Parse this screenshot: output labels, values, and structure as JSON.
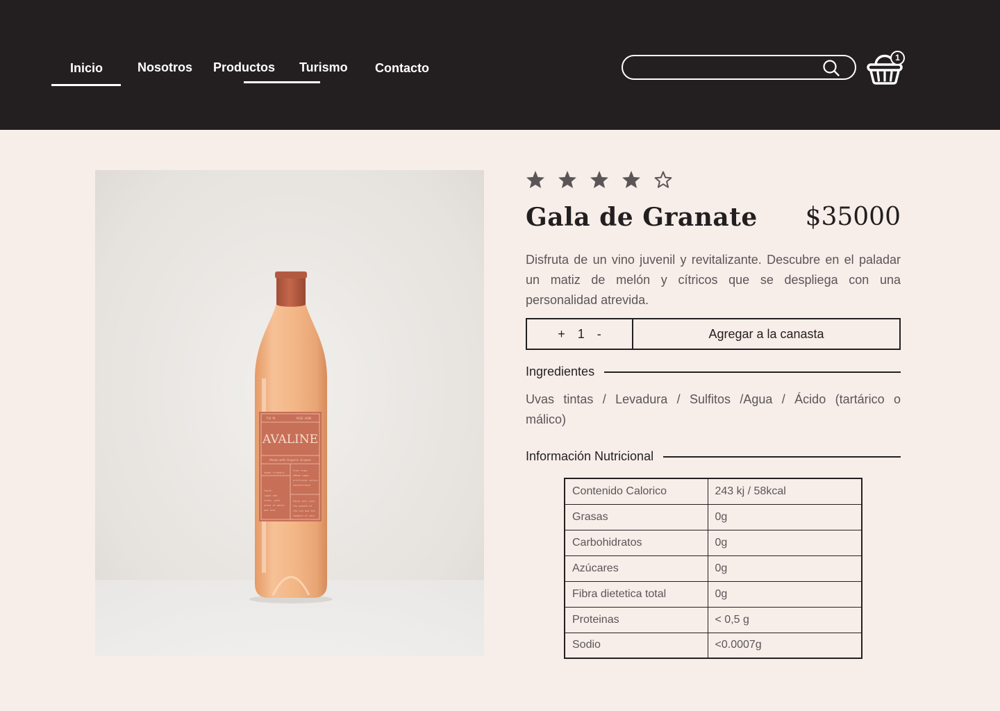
{
  "nav": {
    "items": [
      {
        "label": "Inicio"
      },
      {
        "label": "Nosotros"
      },
      {
        "label": "Productos"
      },
      {
        "label": "Turismo"
      },
      {
        "label": "Contacto"
      }
    ]
  },
  "search": {
    "placeholder": ""
  },
  "cart": {
    "count": "1"
  },
  "product": {
    "rating": 4,
    "rating_max": 5,
    "name": "Gala de Granate",
    "price": "$35000",
    "description": "Disfruta de un vino juvenil y revitalizante. Descubre en el paladar un matiz de melón y cítricos que se despliega con una personalidad atrevida.",
    "bottle": {
      "brand": "AVALINE",
      "subtitle": "Made with Organic Grapes",
      "volume": "750 ML",
      "variety": "ROSÉ WINE"
    }
  },
  "actions": {
    "plus": "+",
    "quantity": "1",
    "minus": "-",
    "add_label": "Agregar a la canasta"
  },
  "ingredients": {
    "heading": "Ingredientes",
    "text": "Uvas tintas / Levadura / Sulfitos /Agua / Ácido (tartárico o málico)"
  },
  "nutrition": {
    "heading": "Información Nutricional",
    "rows": [
      {
        "name": "Contenido Calorico",
        "value": "243 kj / 58kcal"
      },
      {
        "name": "Grasas",
        "value": "0g"
      },
      {
        "name": "Carbohidratos",
        "value": "0g"
      },
      {
        "name": "Azúcares",
        "value": "0g"
      },
      {
        "name": "Fibra dietetica total",
        "value": "0g"
      },
      {
        "name": "Proteinas",
        "value": "< 0,5 g"
      },
      {
        "name": "Sodio",
        "value": "<0.0007g"
      }
    ]
  },
  "colors": {
    "header_bg": "#231f20",
    "page_bg": "#f7eeea",
    "star": "#5b5557",
    "label": "#c76f57"
  }
}
